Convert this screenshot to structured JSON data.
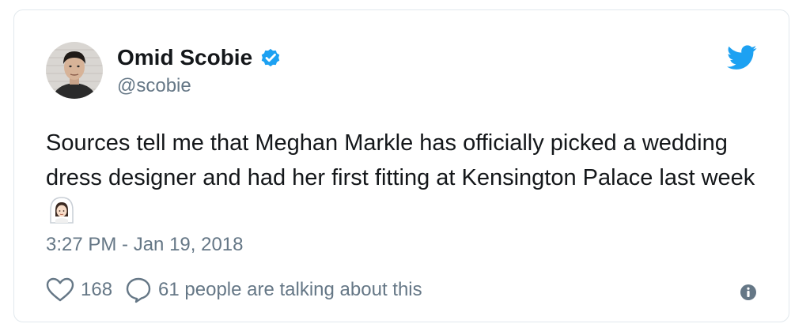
{
  "tweet": {
    "author_name": "Omid Scobie",
    "handle": "@scobie",
    "text": "Sources tell me that Meghan Markle has officially picked a wedding dress designer and had her first fitting at Kensington Palace last week",
    "emoji": "bride-with-veil",
    "timestamp": "3:27 PM - Jan 19, 2018",
    "like_count": "168",
    "conversation_text": "61 people are talking about this"
  },
  "icons": {
    "verified": "verified-badge-icon",
    "brand": "twitter-bird-icon",
    "like": "heart-icon",
    "reply": "speech-bubble-icon",
    "info": "info-icon"
  },
  "colors": {
    "brand_blue": "#1da1f2",
    "text_primary": "#14171a",
    "text_secondary": "#657786",
    "border": "#e1e8ed"
  }
}
